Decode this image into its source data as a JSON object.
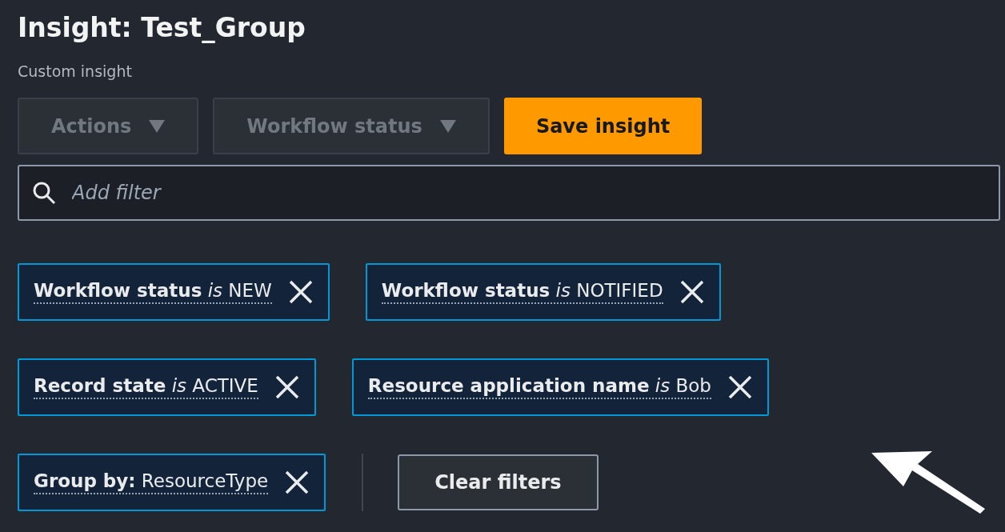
{
  "header": {
    "title": "Insight: Test_Group",
    "subtitle": "Custom insight"
  },
  "buttons": [
    {
      "label": "Actions",
      "kind": "dropdown",
      "disabled": true
    },
    {
      "label": "Workflow status",
      "kind": "dropdown",
      "disabled": true
    },
    {
      "label": "Save insight",
      "kind": "primary",
      "disabled": false
    }
  ],
  "search": {
    "placeholder": "Add filter"
  },
  "token_rows": [
    [
      {
        "text": "**Workflow status** *is* NEW"
      },
      {
        "text": "**Workflow status** *is* NOTIFIED"
      }
    ],
    [
      {
        "text": "**Record state** *is* ACTIVE"
      },
      {
        "text": "**Resource application name** *is* Bob"
      }
    ],
    [
      {
        "text": "**Group by:** ResourceType"
      }
    ]
  ],
  "clear_button": {
    "label": "Clear filters"
  }
}
